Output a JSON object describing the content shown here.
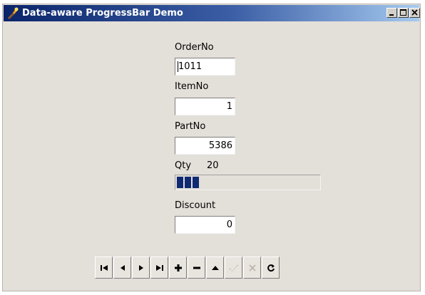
{
  "window": {
    "title": "Data-aware ProgressBar Demo",
    "app_icon": "torch-icon",
    "controls": [
      "minimize-icon",
      "maximize-icon",
      "close-icon"
    ]
  },
  "form": {
    "orderno": {
      "label": "OrderNo",
      "value": "1011"
    },
    "itemno": {
      "label": "ItemNo",
      "value": "1"
    },
    "partno": {
      "label": "PartNo",
      "value": "5386"
    },
    "qty": {
      "label": "Qty",
      "value": "20",
      "progress_percent": 20
    },
    "discount": {
      "label": "Discount",
      "value": "0"
    }
  },
  "navigator": {
    "buttons": [
      {
        "name": "first-record",
        "icon": "first-icon",
        "enabled": true
      },
      {
        "name": "prior-record",
        "icon": "prior-icon",
        "enabled": true
      },
      {
        "name": "next-record",
        "icon": "next-icon",
        "enabled": true
      },
      {
        "name": "last-record",
        "icon": "last-icon",
        "enabled": true
      },
      {
        "name": "insert-record",
        "icon": "plus-icon",
        "enabled": true
      },
      {
        "name": "delete-record",
        "icon": "minus-icon",
        "enabled": true
      },
      {
        "name": "edit-record",
        "icon": "up-triangle-icon",
        "enabled": true
      },
      {
        "name": "post-edit",
        "icon": "check-icon",
        "enabled": false
      },
      {
        "name": "cancel-edit",
        "icon": "x-icon",
        "enabled": false
      },
      {
        "name": "refresh-data",
        "icon": "refresh-icon",
        "enabled": true
      }
    ]
  },
  "colors": {
    "progress_fill": "#0f2a73",
    "window_bg": "#e3dfd9",
    "titlebar_start": "#0a246a",
    "titlebar_end": "#a6caf0"
  }
}
